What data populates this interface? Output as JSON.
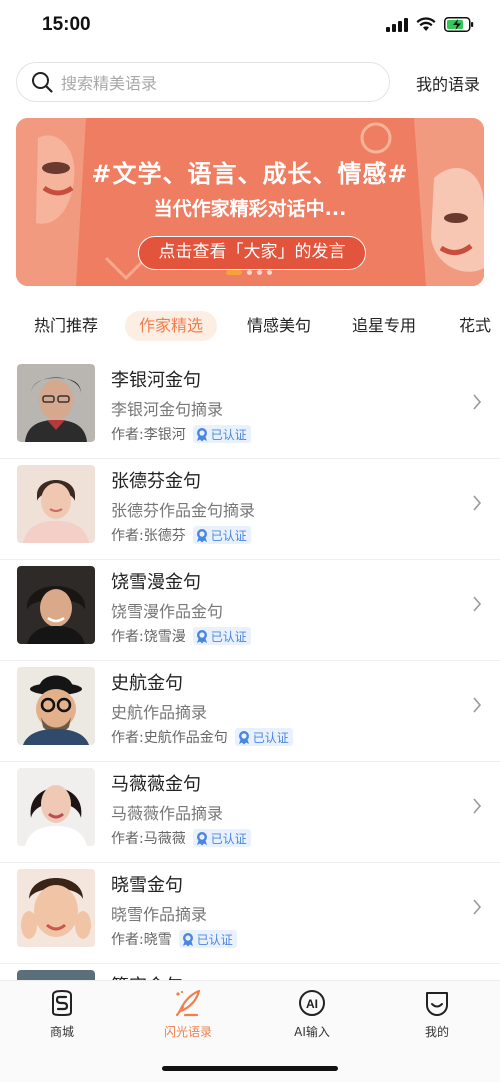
{
  "status_bar": {
    "time": "15:00"
  },
  "search": {
    "placeholder": "搜索精美语录",
    "my_quotes_label": "我的语录"
  },
  "banner": {
    "title": "#文学、语言、成长、情感#",
    "subtitle": "当代作家精彩对话中...",
    "button_label": "点击查看「大家」的发言",
    "slide_count": 3,
    "active_slide": 1
  },
  "tabs": [
    {
      "label": "热门推荐",
      "active": false
    },
    {
      "label": "作家精选",
      "active": true
    },
    {
      "label": "情感美句",
      "active": false
    },
    {
      "label": "追星专用",
      "active": false
    },
    {
      "label": "花式",
      "active": false
    }
  ],
  "items": [
    {
      "title": "李银河金句",
      "desc": "李银河金句摘录",
      "author": "作者:李银河",
      "badge": "已认证"
    },
    {
      "title": "张德芬金句",
      "desc": "张德芬作品金句摘录",
      "author": "作者:张德芬",
      "badge": "已认证"
    },
    {
      "title": "饶雪漫金句",
      "desc": "饶雪漫作品金句",
      "author": "作者:饶雪漫",
      "badge": "已认证"
    },
    {
      "title": "史航金句",
      "desc": "史航作品摘录",
      "author": "作者:史航作品金句",
      "badge": "已认证"
    },
    {
      "title": "马薇薇金句",
      "desc": "马薇薇作品摘录",
      "author": "作者:马薇薇",
      "badge": "已认证"
    },
    {
      "title": "晓雪金句",
      "desc": "晓雪作品摘录",
      "author": "作者:晓雪",
      "badge": "已认证"
    },
    {
      "title": "篇宗金句",
      "desc": "",
      "author": "",
      "badge": ""
    }
  ],
  "bottom_nav": [
    {
      "label": "商城",
      "icon": "shop-icon",
      "active": false
    },
    {
      "label": "闪光语录",
      "icon": "quill-icon",
      "active": true
    },
    {
      "label": "AI输入",
      "icon": "ai-icon",
      "active": false
    },
    {
      "label": "我的",
      "icon": "profile-icon",
      "active": false
    }
  ],
  "colors": {
    "accent": "#f07f4d",
    "banner": "#ee7a5e",
    "verified": "#4a86e0"
  }
}
